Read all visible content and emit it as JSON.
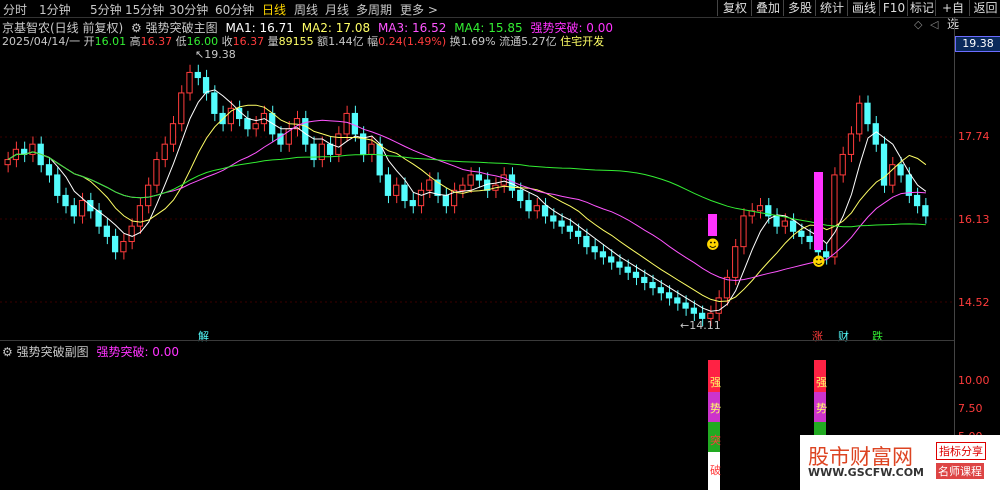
{
  "toolbar": {
    "periods": [
      "分时",
      "1分钟",
      "5分钟",
      "15分钟",
      "30分钟",
      "60分钟",
      "日线",
      "周线",
      "月线",
      "多周期",
      "更多 >"
    ],
    "active_period": "日线",
    "buttons": [
      "复权",
      "叠加",
      "多股",
      "统计",
      "画线",
      "F10",
      "标记",
      "+自选",
      "返回"
    ]
  },
  "header": {
    "stock": "京基智农(日线 前复权)",
    "indicator": "强势突破主图",
    "ma1": "MA1: 16.71",
    "ma2": "MA2: 17.08",
    "ma3": "MA3: 16.52",
    "ma4": "MA4: 15.85",
    "signal": "强势突破: 0.00"
  },
  "quote": {
    "date": "2025/04/14/一",
    "open_label": "开",
    "open": "16.01",
    "high_label": "高",
    "high": "16.37",
    "low_label": "低",
    "low": "16.00",
    "close_label": "收",
    "close": "16.37",
    "vol_label": "量",
    "vol": "89155",
    "amount_label": "额",
    "amount": "1.44亿",
    "change_label": "幅",
    "change": "0.24(1.49%)",
    "turnover_label": "换",
    "turnover": "1.69%",
    "float_label": "流通",
    "float": "5.27亿",
    "sector": "住宅开发"
  },
  "price_axis": {
    "cursor_value": "19.38",
    "ticks": [
      "17.74",
      "16.13",
      "14.52"
    ]
  },
  "annotations": {
    "high_point": "19.38",
    "low_point": "14.11",
    "marker_jie": "解",
    "marker_zhang": "涨",
    "marker_cai": "财",
    "marker_die": "跌"
  },
  "sub_panel": {
    "title": "强势突破副图",
    "value": "强势突破: 0.00",
    "ticks": [
      "10.00",
      "7.50",
      "5.00"
    ],
    "bar_chars": [
      "强",
      "势",
      "突",
      "破"
    ]
  },
  "watermark": {
    "logo": "股市财富网",
    "url": "WWW.GSCFW.COM",
    "tag1": "指标分享",
    "tag2": "名师课程"
  },
  "colors": {
    "up": "#ff3c3c",
    "down": "#54fcfc",
    "ma1": "#ffffff",
    "ma2": "#ffff66",
    "ma3": "#ff55ff",
    "ma4": "#33ee33",
    "signal": "#ff33ff"
  }
}
